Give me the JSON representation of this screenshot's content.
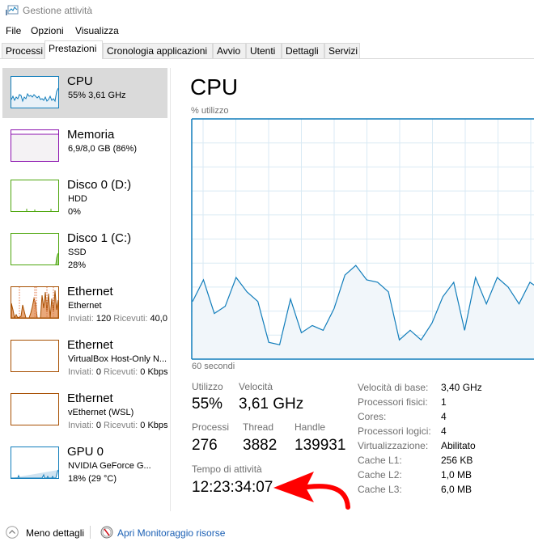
{
  "window": {
    "title": "Gestione attività",
    "app_icon": "task-manager-icon"
  },
  "menu": [
    "File",
    "Opzioni",
    "Visualizza"
  ],
  "tabs": [
    {
      "label": "Processi",
      "active": false
    },
    {
      "label": "Prestazioni",
      "active": true
    },
    {
      "label": "Cronologia applicazioni",
      "active": false
    },
    {
      "label": "Avvio",
      "active": false
    },
    {
      "label": "Utenti",
      "active": false
    },
    {
      "label": "Dettagli",
      "active": false
    },
    {
      "label": "Servizi",
      "active": false
    }
  ],
  "sidebar": {
    "items": [
      {
        "title": "CPU",
        "line1": "55% 3,61 GHz",
        "line2": "",
        "color": "#117dbb",
        "selected": true
      },
      {
        "title": "Memoria",
        "line1": "6,9/8,0 GB (86%)",
        "line2": "",
        "color": "#8b12ae",
        "selected": false
      },
      {
        "title": "Disco 0 (D:)",
        "line1": "HDD",
        "line2": "0%",
        "color": "#4da60c",
        "selected": false
      },
      {
        "title": "Disco 1 (C:)",
        "line1": "SSD",
        "line2": "28%",
        "color": "#4da60c",
        "selected": false
      },
      {
        "title": "Ethernet",
        "line1": "Ethernet",
        "line2_label1": "Inviati:",
        "line2_value1": "120",
        "line2_label2": "Ricevuti:",
        "line2_value2": "40,0",
        "color": "#a74f01",
        "selected": false
      },
      {
        "title": "Ethernet",
        "line1": "VirtualBox Host-Only N...",
        "line2_label1": "Inviati:",
        "line2_value1": "0",
        "line2_label2": "Ricevuti:",
        "line2_value2": "0 Kbps",
        "color": "#a74f01",
        "selected": false
      },
      {
        "title": "Ethernet",
        "line1": "vEthernet (WSL)",
        "line2_label1": "Inviati:",
        "line2_value1": "0",
        "line2_label2": "Ricevuti:",
        "line2_value2": "0 Kbps",
        "color": "#a74f01",
        "selected": false
      },
      {
        "title": "GPU 0",
        "line1": "NVIDIA GeForce G...",
        "line2": "18% (29 °C)",
        "color": "#117dbb",
        "selected": false
      }
    ]
  },
  "main": {
    "title": "CPU",
    "stats": {
      "utilizzo_label": "Utilizzo",
      "utilizzo": "55%",
      "velocita_label": "Velocità",
      "velocita": "3,61 GHz",
      "processi_label": "Processi",
      "processi": "276",
      "thread_label": "Thread",
      "thread": "3882",
      "handle_label": "Handle",
      "handle": "139931",
      "uptime_label": "Tempo di attività",
      "uptime": "12:23:34:07"
    },
    "info": [
      {
        "key": "Velocità di base:",
        "value": "3,40 GHz"
      },
      {
        "key": "Processori fisici:",
        "value": "1"
      },
      {
        "key": "Cores:",
        "value": "4"
      },
      {
        "key": "Processori logici:",
        "value": "4"
      },
      {
        "key": "Virtualizzazione:",
        "value": "Abilitato"
      },
      {
        "key": "Cache L1:",
        "value": "256 KB"
      },
      {
        "key": "Cache L2:",
        "value": "1,0 MB"
      },
      {
        "key": "Cache L3:",
        "value": "6,0 MB"
      }
    ]
  },
  "chart_data": {
    "type": "area",
    "title": "CPU",
    "ylabel": "% utilizzo",
    "xlabel": "60 secondi",
    "ylim": [
      0,
      100
    ],
    "xlim_seconds": [
      60,
      0
    ],
    "grid": true,
    "color": "#117dbb",
    "fill": "#f1f6fa",
    "values": [
      24,
      33,
      19,
      22,
      34,
      28,
      24,
      7,
      6,
      25,
      11,
      14,
      12,
      21,
      35,
      39,
      33,
      32,
      28,
      8,
      12,
      8,
      15,
      26,
      32,
      12,
      34,
      23,
      34,
      30,
      23,
      32,
      29
    ]
  },
  "footer": {
    "less_details": "Meno dettagli",
    "open_monitor": "Apri Monitoraggio risorse"
  },
  "annotation": {
    "type": "arrow",
    "color": "#ff0000",
    "points_to": "uptime"
  }
}
